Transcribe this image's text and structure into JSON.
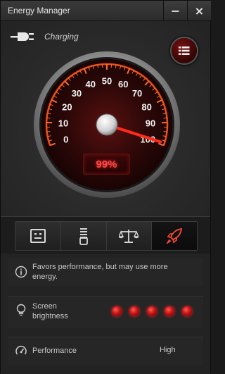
{
  "window": {
    "title": "Energy Manager",
    "minimize_glyph": "−",
    "close_glyph": "×"
  },
  "status": {
    "icon": "power-plug-icon",
    "text": "Charging"
  },
  "gauge": {
    "tick_labels": [
      "0",
      "10",
      "20",
      "30",
      "40",
      "50",
      "60",
      "70",
      "80",
      "90",
      "100"
    ],
    "value_percent": 99,
    "readout": "99%",
    "accent_color": "#ff3b1e"
  },
  "modes": [
    {
      "name": "balanced-mode-icon"
    },
    {
      "name": "battery-saver-mode-icon"
    },
    {
      "name": "scale-mode-icon"
    },
    {
      "name": "performance-mode-icon",
      "active": true
    }
  ],
  "info": {
    "description": "Favors performance, but may use more energy.",
    "brightness_label": "Screen brightness",
    "brightness_level": 5,
    "brightness_max": 5,
    "performance_label": "Performance",
    "performance_value": "High"
  }
}
